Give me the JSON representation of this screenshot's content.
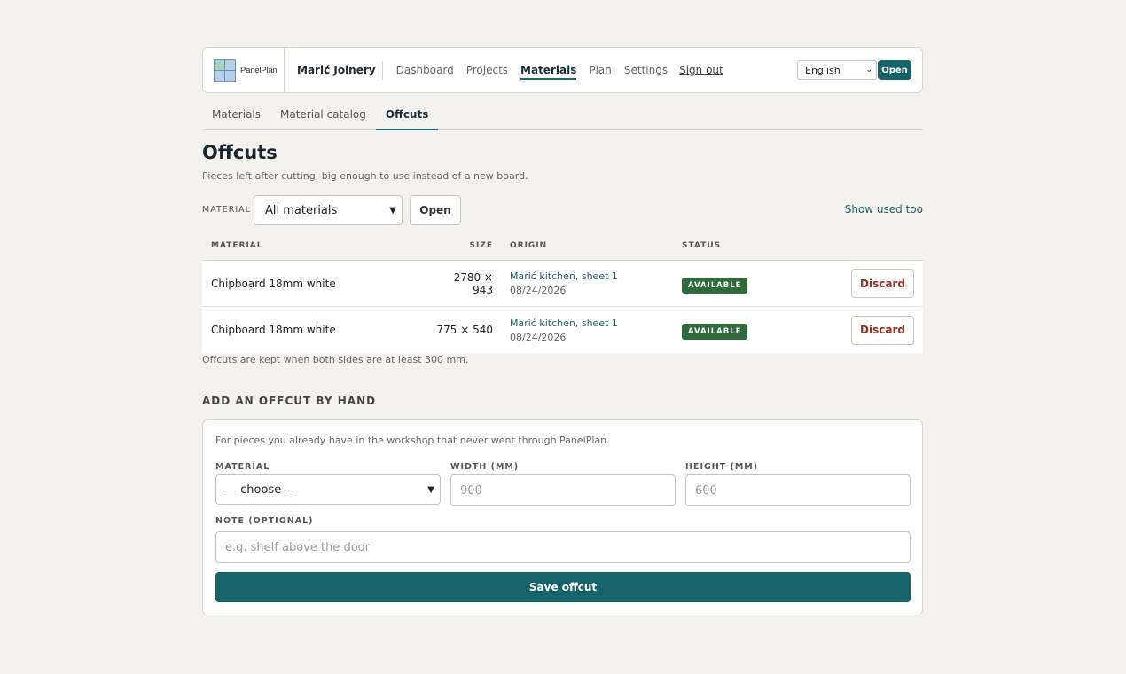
{
  "brand": {
    "logo_text": "PanelPlan",
    "shop_name": "Marić Joinery"
  },
  "nav": {
    "items": [
      {
        "label": "Dashboard"
      },
      {
        "label": "Projects"
      },
      {
        "label": "Materials",
        "active": true
      },
      {
        "label": "Plan"
      },
      {
        "label": "Settings"
      }
    ],
    "signout": "Sign out",
    "language": "English",
    "open_label": "Open"
  },
  "subtabs": [
    {
      "label": "Materials"
    },
    {
      "label": "Material catalog"
    },
    {
      "label": "Offcuts",
      "active": true
    }
  ],
  "page": {
    "title": "Offcuts",
    "subtitle": "Pieces left after cutting, big enough to use instead of a new board."
  },
  "filter": {
    "label": "MATERIAL",
    "selected": "All materials",
    "open_label": "Open",
    "show_used": "Show used too"
  },
  "table": {
    "headers": {
      "material": "MATERIAL",
      "size": "SIZE",
      "origin": "ORIGIN",
      "status": "STATUS"
    },
    "rows": [
      {
        "material": "Chipboard 18mm white",
        "size": "2780 × 943",
        "origin": "Marić kitchen, sheet 1",
        "date": "08/24/2026",
        "status": "AVAILABLE",
        "action": "Discard"
      },
      {
        "material": "Chipboard 18mm white",
        "size": "775 × 540",
        "origin": "Marić kitchen, sheet 1",
        "date": "08/24/2026",
        "status": "AVAILABLE",
        "action": "Discard"
      }
    ],
    "note": "Offcuts are kept when both sides are at least 300 mm."
  },
  "add_form": {
    "section_title": "ADD AN OFFCUT BY HAND",
    "intro": "For pieces you already have in the workshop that never went through PanelPlan.",
    "material_label": "MATERIAL",
    "material_selected": "— choose —",
    "width_label": "WIDTH (MM)",
    "width_placeholder": "900",
    "height_label": "HEIGHT (MM)",
    "height_placeholder": "600",
    "note_label": "NOTE (OPTIONAL)",
    "note_placeholder": "e.g. shelf above the door",
    "save_label": "Save offcut"
  },
  "colors": {
    "accent": "#16636a",
    "status_available": "#2f6a3a",
    "danger": "#9a2f22",
    "background": "#f4f2ee"
  }
}
